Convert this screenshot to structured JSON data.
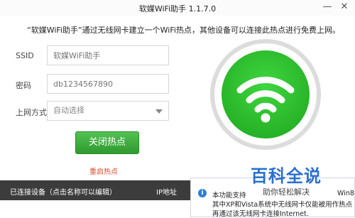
{
  "window": {
    "title": "软媒WiFi助手 1.1.7.0",
    "controls": {
      "minimize": "—",
      "close": "✕"
    }
  },
  "intro": "“软媒WiFi助手”通过无线网卡建立一个WiFi热点，其他设备可以连接此热点进行免费上网。",
  "form": {
    "ssid": {
      "label": "SSID",
      "placeholder": "软媒WiFi助手"
    },
    "password": {
      "label": "密码",
      "placeholder": "db1234567890"
    },
    "network": {
      "label": "上网方式",
      "value": "自动选择"
    }
  },
  "buttons": {
    "close_hotspot": "关闭热点",
    "restart_hotspot": "重启热点"
  },
  "status": {
    "icon": "wifi-icon",
    "color": "#2bb52b"
  },
  "table": {
    "columns": [
      "已连接设备（点击名称可以编辑）",
      "IP地址"
    ]
  },
  "notice": {
    "icon": "info-icon",
    "lines": [
      "本功能支持",
      "其中XP和Vista系统中无线网卡仅能被用作热点",
      "再通过该无线网卡连接Internet."
    ],
    "trailing": "Win8"
  },
  "watermark": {
    "title": "百科全说",
    "subtitle": "助你轻松解决"
  }
}
